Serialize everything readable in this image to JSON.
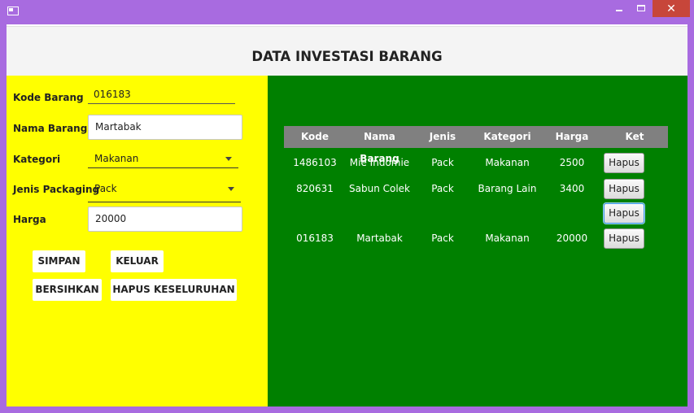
{
  "window": {
    "close_symbol": "✕",
    "icons": [
      "app-icon",
      "minimize-icon",
      "maximize-icon",
      "close-icon"
    ]
  },
  "header": {
    "title": "DATA INVESTASI BARANG"
  },
  "form": {
    "kode_label": "Kode Barang",
    "kode_value": "016183",
    "nama_label": "Nama Barang",
    "nama_value": "Martabak",
    "kategori_label": "Kategori",
    "kategori_value": "Makanan",
    "packaging_label": "Jenis Packaging",
    "packaging_value": "Pack",
    "harga_label": "Harga",
    "harga_value": "20000"
  },
  "buttons": {
    "simpan": "SIMPAN",
    "keluar": "KELUAR",
    "bersihkan": "BERSIHKAN",
    "hapus_semua": "HAPUS KESELURUHAN"
  },
  "table": {
    "columns": [
      "Kode",
      "Nama Barang",
      "Jenis",
      "Kategori",
      "Harga",
      "Ket"
    ],
    "rows": [
      {
        "kode": "1486103",
        "nama": "Mie Indomie",
        "jenis": "Pack",
        "kategori": "Makanan",
        "harga": "2500",
        "ket": "Hapus"
      },
      {
        "kode": "820631",
        "nama": "Sabun Colek",
        "jenis": "Pack",
        "kategori": "Barang Lain",
        "harga": "3400",
        "ket": "Hapus"
      },
      {
        "kode": "",
        "nama": "",
        "jenis": "",
        "kategori": "",
        "harga": "",
        "ket": "Hapus"
      },
      {
        "kode": "016183",
        "nama": "Martabak",
        "jenis": "Pack",
        "kategori": "Makanan",
        "harga": "20000",
        "ket": "Hapus"
      }
    ]
  },
  "colors": {
    "left_pane": "#ffff00",
    "right_pane": "#008000",
    "table_header": "#808080",
    "titlebar": "#a86be0",
    "close_button": "#c7463a"
  }
}
